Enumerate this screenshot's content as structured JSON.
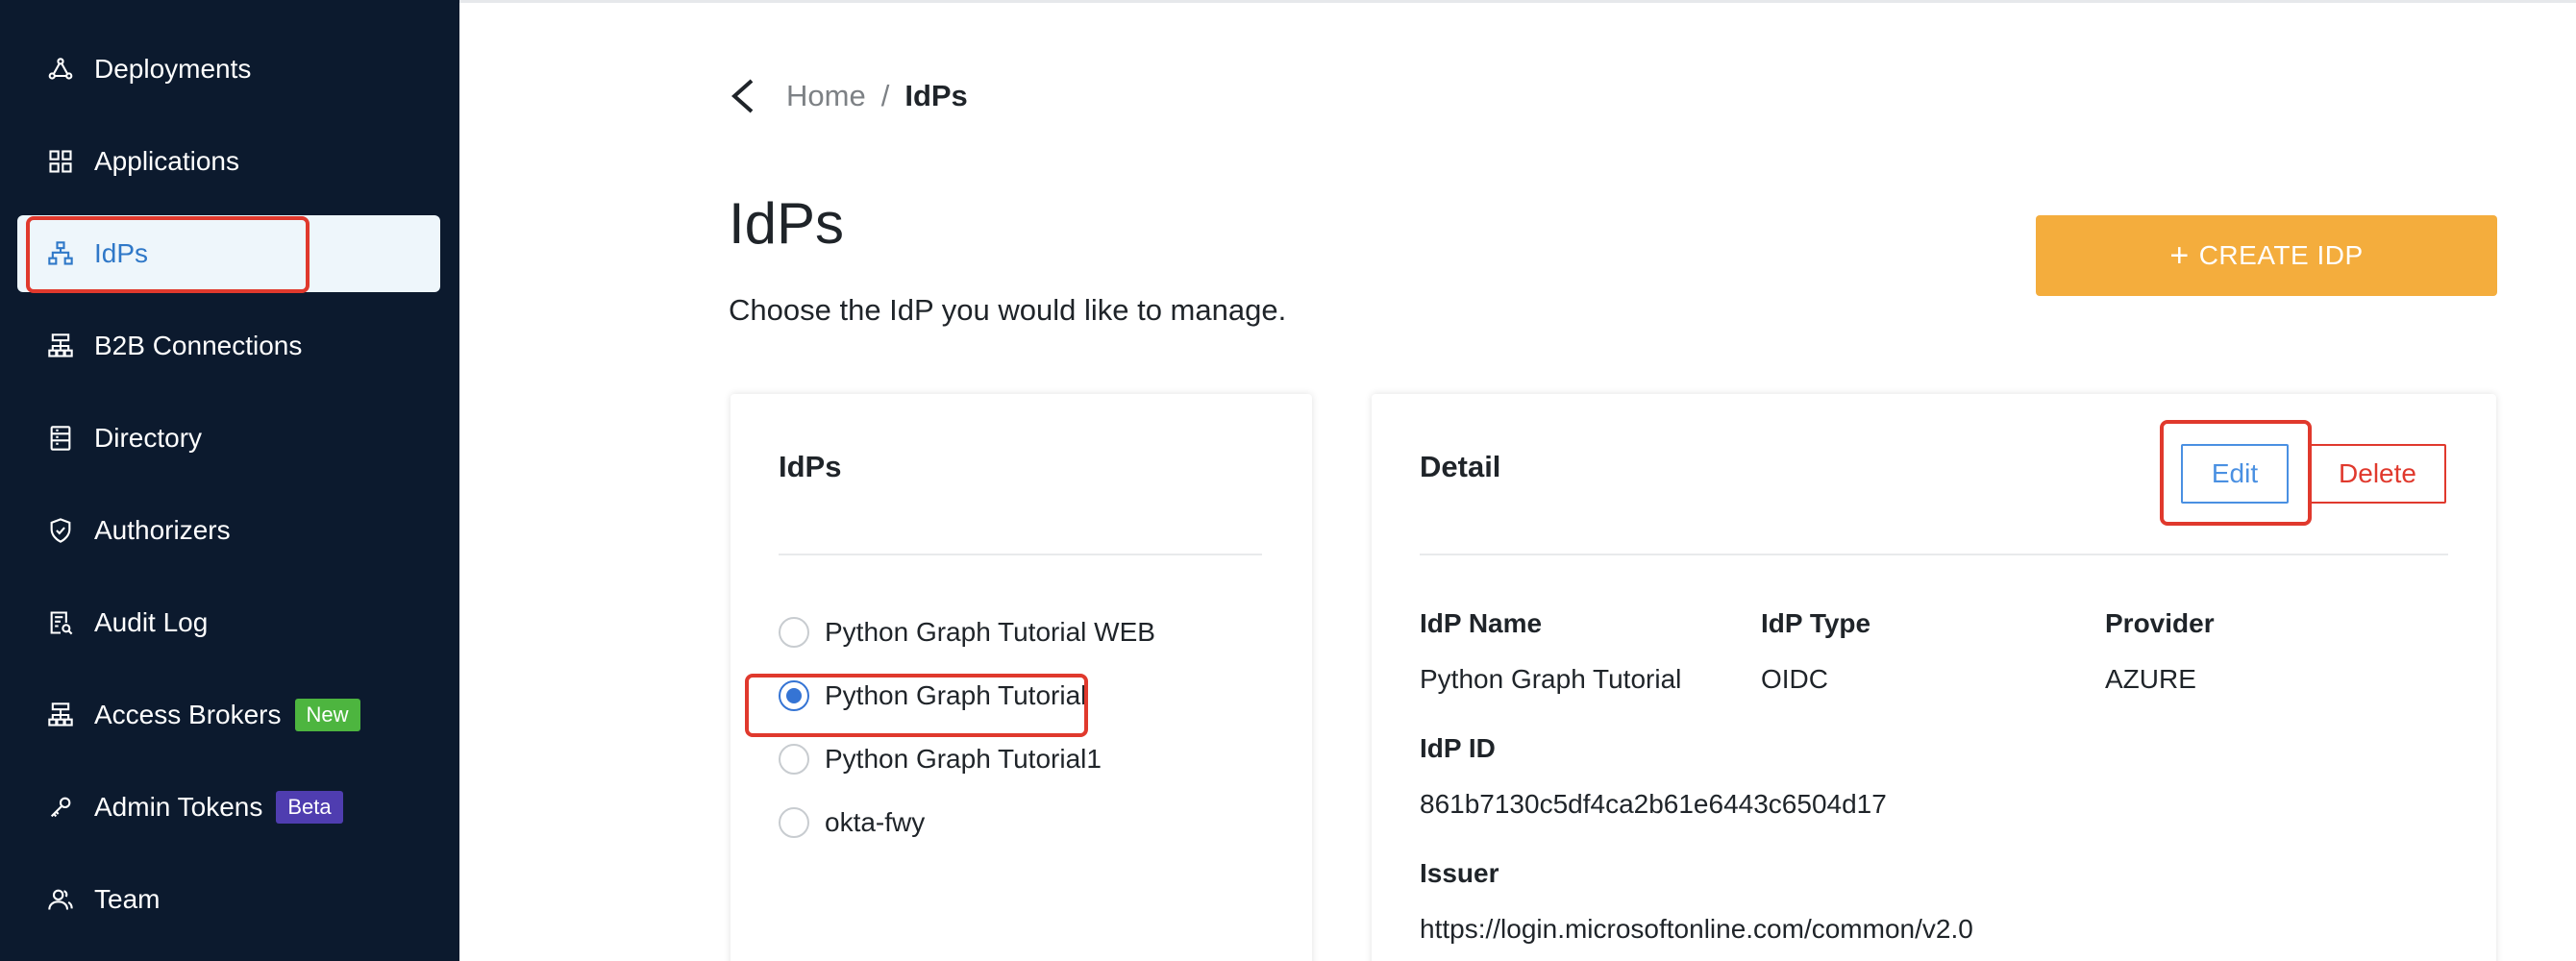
{
  "sidebar": {
    "items": [
      {
        "label": "Deployments",
        "icon": "deployments-icon"
      },
      {
        "label": "Applications",
        "icon": "applications-grid-icon"
      },
      {
        "label": "IdPs",
        "icon": "idps-hierarchy-icon",
        "active": true
      },
      {
        "label": "B2B Connections",
        "icon": "b2b-connections-icon"
      },
      {
        "label": "Directory",
        "icon": "directory-icon"
      },
      {
        "label": "Authorizers",
        "icon": "shield-check-icon"
      },
      {
        "label": "Audit Log",
        "icon": "audit-log-icon"
      },
      {
        "label": "Access Brokers",
        "icon": "access-brokers-icon",
        "badge": "New"
      },
      {
        "label": "Admin Tokens",
        "icon": "admin-tokens-icon",
        "badge": "Beta"
      },
      {
        "label": "Team",
        "icon": "team-icon"
      }
    ]
  },
  "breadcrumb": {
    "home": "Home",
    "separator": "/",
    "current": "IdPs"
  },
  "page": {
    "title": "IdPs",
    "subtitle": "Choose the IdP you would like to manage.",
    "create_button": "CREATE IDP"
  },
  "idp_list": {
    "title": "IdPs",
    "items": [
      {
        "label": "Python Graph Tutorial WEB",
        "selected": false
      },
      {
        "label": "Python Graph Tutorial",
        "selected": true
      },
      {
        "label": "Python Graph Tutorial1",
        "selected": false
      },
      {
        "label": "okta-fwy",
        "selected": false
      }
    ]
  },
  "detail": {
    "title": "Detail",
    "edit_label": "Edit",
    "delete_label": "Delete",
    "idp_name_label": "IdP Name",
    "idp_name_value": "Python Graph Tutorial",
    "idp_type_label": "IdP Type",
    "idp_type_value": "OIDC",
    "provider_label": "Provider",
    "provider_value": "AZURE",
    "idp_id_label": "IdP ID",
    "idp_id_value": "861b7130c5df4ca2b61e6443c6504d17",
    "issuer_label": "Issuer",
    "issuer_value": "https://login.microsoftonline.com/common/v2.0"
  },
  "colors": {
    "sidebar_bg": "#0c1a2e",
    "accent_blue": "#2f78c8",
    "create_button": "#f4ad3d",
    "highlight_red": "#e0392d",
    "badge_new": "#4db53f",
    "badge_beta": "#4f3db0"
  }
}
